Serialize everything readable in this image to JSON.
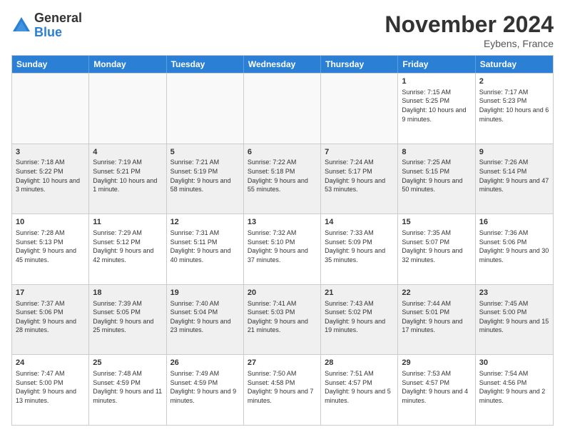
{
  "logo": {
    "general": "General",
    "blue": "Blue"
  },
  "title": "November 2024",
  "location": "Eybens, France",
  "header_days": [
    "Sunday",
    "Monday",
    "Tuesday",
    "Wednesday",
    "Thursday",
    "Friday",
    "Saturday"
  ],
  "weeks": [
    [
      {
        "day": "",
        "info": ""
      },
      {
        "day": "",
        "info": ""
      },
      {
        "day": "",
        "info": ""
      },
      {
        "day": "",
        "info": ""
      },
      {
        "day": "",
        "info": ""
      },
      {
        "day": "1",
        "info": "Sunrise: 7:15 AM\nSunset: 5:25 PM\nDaylight: 10 hours and 9 minutes."
      },
      {
        "day": "2",
        "info": "Sunrise: 7:17 AM\nSunset: 5:23 PM\nDaylight: 10 hours and 6 minutes."
      }
    ],
    [
      {
        "day": "3",
        "info": "Sunrise: 7:18 AM\nSunset: 5:22 PM\nDaylight: 10 hours and 3 minutes."
      },
      {
        "day": "4",
        "info": "Sunrise: 7:19 AM\nSunset: 5:21 PM\nDaylight: 10 hours and 1 minute."
      },
      {
        "day": "5",
        "info": "Sunrise: 7:21 AM\nSunset: 5:19 PM\nDaylight: 9 hours and 58 minutes."
      },
      {
        "day": "6",
        "info": "Sunrise: 7:22 AM\nSunset: 5:18 PM\nDaylight: 9 hours and 55 minutes."
      },
      {
        "day": "7",
        "info": "Sunrise: 7:24 AM\nSunset: 5:17 PM\nDaylight: 9 hours and 53 minutes."
      },
      {
        "day": "8",
        "info": "Sunrise: 7:25 AM\nSunset: 5:15 PM\nDaylight: 9 hours and 50 minutes."
      },
      {
        "day": "9",
        "info": "Sunrise: 7:26 AM\nSunset: 5:14 PM\nDaylight: 9 hours and 47 minutes."
      }
    ],
    [
      {
        "day": "10",
        "info": "Sunrise: 7:28 AM\nSunset: 5:13 PM\nDaylight: 9 hours and 45 minutes."
      },
      {
        "day": "11",
        "info": "Sunrise: 7:29 AM\nSunset: 5:12 PM\nDaylight: 9 hours and 42 minutes."
      },
      {
        "day": "12",
        "info": "Sunrise: 7:31 AM\nSunset: 5:11 PM\nDaylight: 9 hours and 40 minutes."
      },
      {
        "day": "13",
        "info": "Sunrise: 7:32 AM\nSunset: 5:10 PM\nDaylight: 9 hours and 37 minutes."
      },
      {
        "day": "14",
        "info": "Sunrise: 7:33 AM\nSunset: 5:09 PM\nDaylight: 9 hours and 35 minutes."
      },
      {
        "day": "15",
        "info": "Sunrise: 7:35 AM\nSunset: 5:07 PM\nDaylight: 9 hours and 32 minutes."
      },
      {
        "day": "16",
        "info": "Sunrise: 7:36 AM\nSunset: 5:06 PM\nDaylight: 9 hours and 30 minutes."
      }
    ],
    [
      {
        "day": "17",
        "info": "Sunrise: 7:37 AM\nSunset: 5:06 PM\nDaylight: 9 hours and 28 minutes."
      },
      {
        "day": "18",
        "info": "Sunrise: 7:39 AM\nSunset: 5:05 PM\nDaylight: 9 hours and 25 minutes."
      },
      {
        "day": "19",
        "info": "Sunrise: 7:40 AM\nSunset: 5:04 PM\nDaylight: 9 hours and 23 minutes."
      },
      {
        "day": "20",
        "info": "Sunrise: 7:41 AM\nSunset: 5:03 PM\nDaylight: 9 hours and 21 minutes."
      },
      {
        "day": "21",
        "info": "Sunrise: 7:43 AM\nSunset: 5:02 PM\nDaylight: 9 hours and 19 minutes."
      },
      {
        "day": "22",
        "info": "Sunrise: 7:44 AM\nSunset: 5:01 PM\nDaylight: 9 hours and 17 minutes."
      },
      {
        "day": "23",
        "info": "Sunrise: 7:45 AM\nSunset: 5:00 PM\nDaylight: 9 hours and 15 minutes."
      }
    ],
    [
      {
        "day": "24",
        "info": "Sunrise: 7:47 AM\nSunset: 5:00 PM\nDaylight: 9 hours and 13 minutes."
      },
      {
        "day": "25",
        "info": "Sunrise: 7:48 AM\nSunset: 4:59 PM\nDaylight: 9 hours and 11 minutes."
      },
      {
        "day": "26",
        "info": "Sunrise: 7:49 AM\nSunset: 4:59 PM\nDaylight: 9 hours and 9 minutes."
      },
      {
        "day": "27",
        "info": "Sunrise: 7:50 AM\nSunset: 4:58 PM\nDaylight: 9 hours and 7 minutes."
      },
      {
        "day": "28",
        "info": "Sunrise: 7:51 AM\nSunset: 4:57 PM\nDaylight: 9 hours and 5 minutes."
      },
      {
        "day": "29",
        "info": "Sunrise: 7:53 AM\nSunset: 4:57 PM\nDaylight: 9 hours and 4 minutes."
      },
      {
        "day": "30",
        "info": "Sunrise: 7:54 AM\nSunset: 4:56 PM\nDaylight: 9 hours and 2 minutes."
      }
    ]
  ]
}
